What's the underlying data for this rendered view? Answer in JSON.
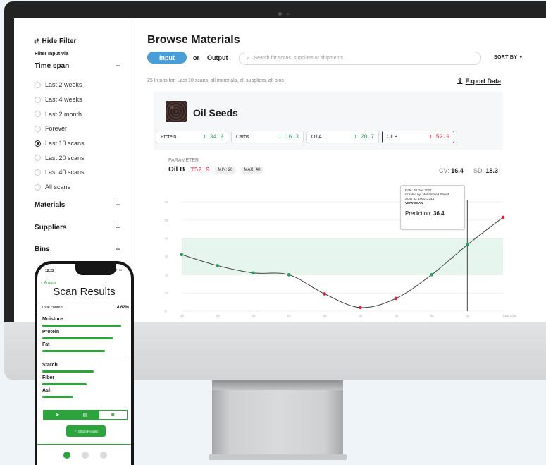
{
  "sidebar": {
    "hide_filter": "Hide Filter",
    "filter_input_via": "Filter Input via",
    "time_span": "Time span",
    "time_span_toggle": "−",
    "time_options": [
      {
        "label": "Last 2 weeks",
        "selected": false
      },
      {
        "label": "Last 4 weeks",
        "selected": false
      },
      {
        "label": "Last 2 month",
        "selected": false
      },
      {
        "label": "Forever",
        "selected": false
      },
      {
        "label": "Last 10 scans",
        "selected": true
      },
      {
        "label": "Last 20 scans",
        "selected": false
      },
      {
        "label": "Last 40 scans",
        "selected": false
      },
      {
        "label": "All scans",
        "selected": false
      }
    ],
    "materials": "Materials",
    "suppliers": "Suppliers",
    "bins": "Bins",
    "expand": "+"
  },
  "main": {
    "title": "Browse Materials",
    "input_tab": "Input",
    "or": "or",
    "output_tab": "Output",
    "search_placeholder": "Search for scans, suppliers or shipments...",
    "sort_by": "SORT BY",
    "summary": "25 Inputs for: Last 10 scans, all materials, all suppliers, all bins",
    "export": "Export Data"
  },
  "material": {
    "name": "Oil Seeds",
    "chips": [
      {
        "label": "Protein",
        "value": "34.2",
        "status": "ok"
      },
      {
        "label": "Carbs",
        "value": "16.3",
        "status": "ok"
      },
      {
        "label": "Oil A",
        "value": "20.7",
        "status": "ok"
      },
      {
        "label": "Oil B",
        "value": "52.9",
        "status": "alert"
      }
    ]
  },
  "parameter": {
    "label": "PARAMETER",
    "name": "Oil B",
    "value": "52.9",
    "min": "MIN: 20",
    "max": "MAX: 40",
    "cv_label": "CV:",
    "cv": "16.4",
    "sd_label": "SD:",
    "sd": "18.3"
  },
  "tooltip": {
    "date": "Date: 20 Dec 2022",
    "created_by": "Created by: Mohammed Sayed",
    "scan_id": "Scan ID: 100012344",
    "view_scan": "VIEW SCAN",
    "prediction_label": "Prediction:",
    "prediction": "36.4"
  },
  "colors": {
    "ok": "#2c9b5e",
    "alert": "#d6243a",
    "accent": "#4a9ed8",
    "band": "#e6f6ee",
    "app_green": "#2aa43b"
  },
  "chart_data": {
    "type": "line",
    "categories": [
      "10",
      "09",
      "08",
      "07",
      "06",
      "05",
      "04",
      "03",
      "02",
      "Last scan"
    ],
    "values": [
      31,
      25,
      21,
      20,
      9.5,
      2,
      7,
      20,
      36.4,
      51.5
    ],
    "ylim": [
      0,
      60
    ],
    "yticks": [
      "0",
      "10",
      "20",
      "30",
      "40",
      "50",
      "60"
    ],
    "band": [
      20,
      40
    ],
    "highlight_index": 8
  },
  "phone": {
    "time": "12:22",
    "status": "..ıl ᯤ ▭",
    "analyze": "Analyze",
    "title": "Scan Results",
    "total_label": "Total content",
    "total_value": "4.62%",
    "items": [
      {
        "label": "Moisture",
        "fill": 0.95
      },
      {
        "label": "Protein",
        "fill": 0.85
      },
      {
        "label": "Fat",
        "fill": 0.75
      },
      {
        "label": "Starch",
        "fill": 0.62
      },
      {
        "label": "Fiber",
        "fill": 0.53
      },
      {
        "label": "Ash",
        "fill": 0.37
      }
    ],
    "share": "Share Results"
  }
}
